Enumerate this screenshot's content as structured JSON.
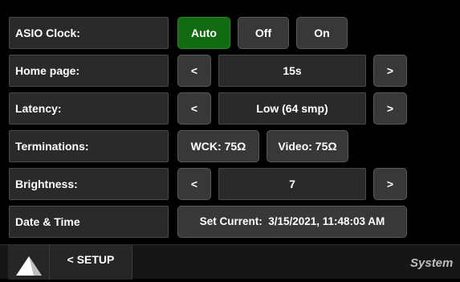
{
  "rows": {
    "asio_clock": {
      "label": "ASIO Clock:",
      "options": [
        "Auto",
        "Off",
        "On"
      ],
      "selected": "Auto"
    },
    "home_page": {
      "label": "Home page:",
      "prev": "<",
      "value": "15s",
      "next": ">"
    },
    "latency": {
      "label": "Latency:",
      "prev": "<",
      "value": "Low (64 smp)",
      "next": ">"
    },
    "terminations": {
      "label": "Terminations:",
      "wck": "WCK: 75Ω",
      "video": "Video: 75Ω"
    },
    "brightness": {
      "label": "Brightness:",
      "prev": "<",
      "value": "7",
      "next": ">"
    },
    "date_time": {
      "label": "Date & Time",
      "button": "Set Current:  3/15/2021, 11:48:03 AM"
    }
  },
  "footer": {
    "logo_icon": "triangle-logo-icon",
    "setup_button": "< SETUP",
    "section_label": "System"
  },
  "colors": {
    "background": "#000000",
    "active_button": "#126b12",
    "button": "#383838",
    "label_background": "#2a2a2a"
  }
}
